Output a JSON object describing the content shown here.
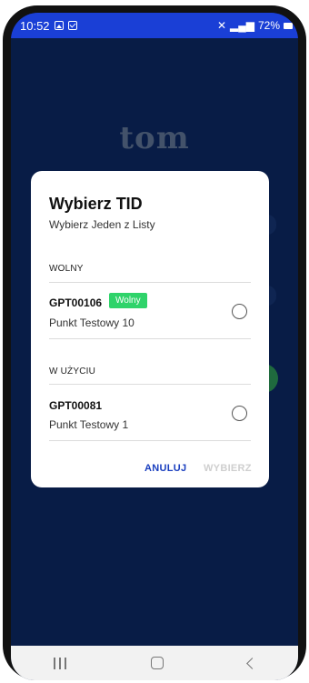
{
  "status_bar": {
    "time": "10:52",
    "battery": "72%"
  },
  "background": {
    "logo": "tom"
  },
  "dialog": {
    "title": "Wybierz TID",
    "subtitle": "Wybierz Jeden z Listy",
    "sections": [
      {
        "label": "WOLNY",
        "items": [
          {
            "id": "GPT00106",
            "badge": "Wolny",
            "name": "Punkt Testowy 10",
            "selected": false
          }
        ]
      },
      {
        "label": "W UŻYCIU",
        "items": [
          {
            "id": "GPT00081",
            "name": "Punkt Testowy 1",
            "selected": false
          }
        ]
      }
    ],
    "cancel_label": "ANULUJ",
    "choose_label": "WYBIERZ"
  },
  "colors": {
    "app_background": "#0b2250",
    "status_bar": "#1a3fd6",
    "badge": "#2fd36a",
    "accent": "#1a3fbf"
  }
}
